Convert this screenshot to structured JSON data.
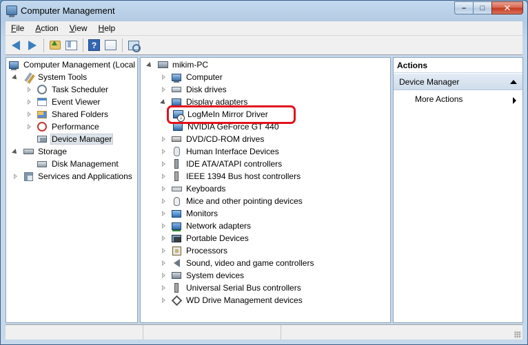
{
  "window": {
    "title": "Computer Management",
    "controls": {
      "minimize": "–",
      "maximize": "□",
      "close": "✕"
    }
  },
  "menu": [
    "File",
    "Action",
    "View",
    "Help"
  ],
  "menu_underline": [
    "F",
    "A",
    "V",
    "H"
  ],
  "toolbar": {
    "icons": [
      "back-arrow-icon",
      "forward-arrow-icon",
      "up-folder-icon",
      "show-hide-tree-icon",
      "help-icon",
      "properties-icon",
      "scan-hardware-icon"
    ],
    "help_glyph": "?"
  },
  "left_tree": {
    "root": "Computer Management (Local",
    "items": [
      {
        "label": "System Tools",
        "level": 1,
        "state": "open",
        "icon": "tools-icon"
      },
      {
        "label": "Task Scheduler",
        "level": 2,
        "state": "closed",
        "icon": "clock-icon"
      },
      {
        "label": "Event Viewer",
        "level": 2,
        "state": "closed",
        "icon": "event-viewer-icon"
      },
      {
        "label": "Shared Folders",
        "level": 2,
        "state": "closed",
        "icon": "shared-folders-icon"
      },
      {
        "label": "Performance",
        "level": 2,
        "state": "closed",
        "icon": "performance-icon"
      },
      {
        "label": "Device Manager",
        "level": 2,
        "state": "none",
        "icon": "device-manager-icon",
        "selected": true
      },
      {
        "label": "Storage",
        "level": 1,
        "state": "open",
        "icon": "storage-icon"
      },
      {
        "label": "Disk Management",
        "level": 2,
        "state": "none",
        "icon": "disk-management-icon"
      },
      {
        "label": "Services and Applications",
        "level": 1,
        "state": "closed",
        "icon": "services-icon"
      }
    ]
  },
  "device_tree": {
    "root": "mikim-PC",
    "items": [
      {
        "label": "Computer",
        "state": "closed",
        "icon": "computer-icon"
      },
      {
        "label": "Disk drives",
        "state": "closed",
        "icon": "disk-drive-icon"
      },
      {
        "label": "Display adapters",
        "state": "open",
        "icon": "display-adapter-icon"
      },
      {
        "label": "LogMeIn Mirror Driver",
        "state": "child",
        "icon": "logmein-driver-icon",
        "highlighted": true
      },
      {
        "label": "NVIDIA GeForce GT 440",
        "state": "child",
        "icon": "display-adapter-icon"
      },
      {
        "label": "DVD/CD-ROM drives",
        "state": "closed",
        "icon": "dvd-drive-icon"
      },
      {
        "label": "Human Interface Devices",
        "state": "closed",
        "icon": "hid-icon"
      },
      {
        "label": "IDE ATA/ATAPI controllers",
        "state": "closed",
        "icon": "ide-controller-icon"
      },
      {
        "label": "IEEE 1394 Bus host controllers",
        "state": "closed",
        "icon": "ieee1394-icon"
      },
      {
        "label": "Keyboards",
        "state": "closed",
        "icon": "keyboard-icon"
      },
      {
        "label": "Mice and other pointing devices",
        "state": "closed",
        "icon": "mouse-icon"
      },
      {
        "label": "Monitors",
        "state": "closed",
        "icon": "monitor-icon"
      },
      {
        "label": "Network adapters",
        "state": "closed",
        "icon": "network-adapter-icon"
      },
      {
        "label": "Portable Devices",
        "state": "closed",
        "icon": "portable-device-icon"
      },
      {
        "label": "Processors",
        "state": "closed",
        "icon": "processor-icon"
      },
      {
        "label": "Sound, video and game controllers",
        "state": "closed",
        "icon": "sound-icon"
      },
      {
        "label": "System devices",
        "state": "closed",
        "icon": "system-device-icon"
      },
      {
        "label": "Universal Serial Bus controllers",
        "state": "closed",
        "icon": "usb-icon"
      },
      {
        "label": "WD Drive Management devices",
        "state": "closed",
        "icon": "wd-drive-icon"
      }
    ]
  },
  "actions": {
    "header": "Actions",
    "section": "Device Manager",
    "more": "More Actions"
  },
  "colors": {
    "highlight_ring": "#e3101b",
    "selection_bg": "#dde3ea",
    "actions_section_bg": "#cfdcea"
  }
}
